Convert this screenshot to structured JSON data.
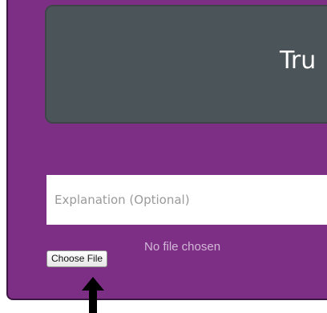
{
  "header": {
    "title": "Tru"
  },
  "form": {
    "explanation_placeholder": "Explanation (Optional)",
    "explanation_value": ""
  },
  "file_input": {
    "button_label": "Choose File",
    "status": "No file chosen"
  },
  "colors": {
    "frame_bg": "#7d2f86",
    "header_bg": "#4b5459",
    "annotation_arrow": "#000000"
  },
  "icons": {
    "annotation": "arrow-up-icon"
  }
}
